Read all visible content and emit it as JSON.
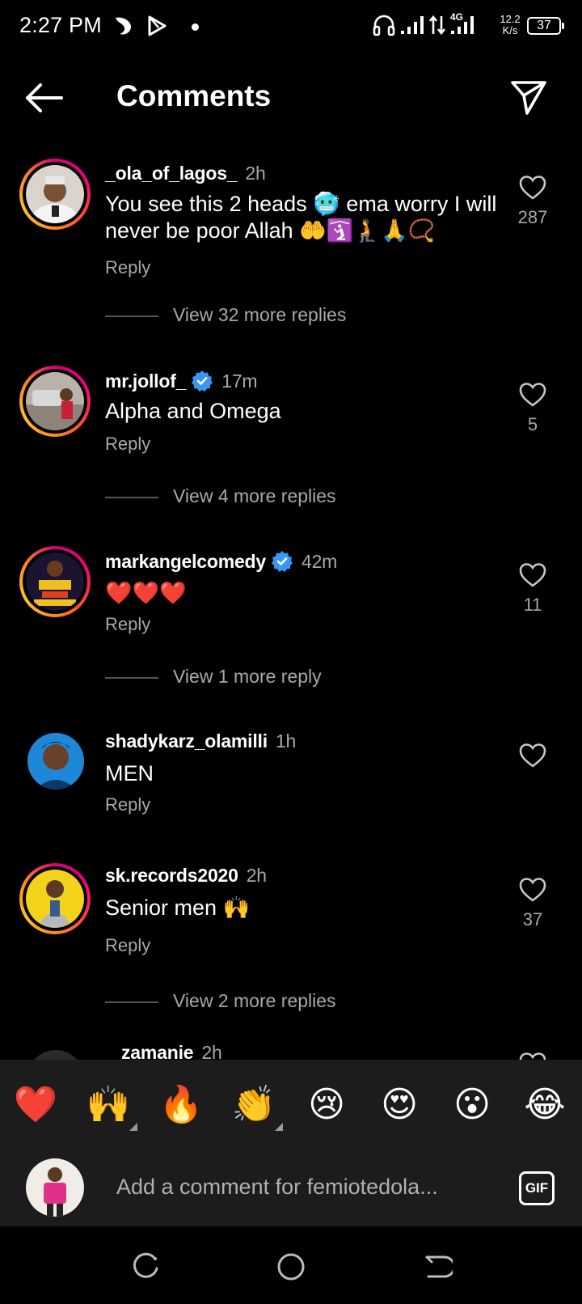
{
  "status_bar": {
    "time": "2:27 PM",
    "network_label": "4G",
    "speed_value": "12.2",
    "speed_unit": "K/s",
    "battery": "37"
  },
  "header": {
    "title": "Comments"
  },
  "comments": [
    {
      "username": "_ola_of_lagos_",
      "time": "2h",
      "verified": false,
      "text": "You see this 2 heads 🥶 ema worry I will never be poor Allah 🤲🛐🧎🙏📿",
      "reply_label": "Reply",
      "likes": "287",
      "view_replies": "View 32 more replies"
    },
    {
      "username": "mr.jollof_",
      "time": "17m",
      "verified": true,
      "text": "Alpha and Omega",
      "reply_label": "Reply",
      "likes": "5",
      "view_replies": "View 4 more replies"
    },
    {
      "username": "markangelcomedy",
      "time": "42m",
      "verified": true,
      "text": "❤️❤️❤️",
      "reply_label": "Reply",
      "likes": "11",
      "view_replies": "View 1 more reply"
    },
    {
      "username": "shadykarz_olamilli",
      "time": "1h",
      "verified": false,
      "text": "MEN",
      "reply_label": "Reply",
      "likes": ""
    },
    {
      "username": "sk.records2020",
      "time": "2h",
      "verified": false,
      "text": "Senior men 🙌",
      "reply_label": "Reply",
      "likes": "37",
      "view_replies": "View 2 more replies"
    },
    {
      "username": "zamanie",
      "time": "2h"
    }
  ],
  "emoji_bar": [
    "❤️",
    "🙌",
    "🔥",
    "👏",
    "😢",
    "😍",
    "😮",
    "😂"
  ],
  "compose": {
    "placeholder": "Add a comment for femiotedola...",
    "gif_label": "GIF"
  },
  "colors": {
    "background": "#000000",
    "secondary_text": "#a8a8a8",
    "verified_blue": "#3897f0",
    "panel": "#1c1c1c"
  }
}
